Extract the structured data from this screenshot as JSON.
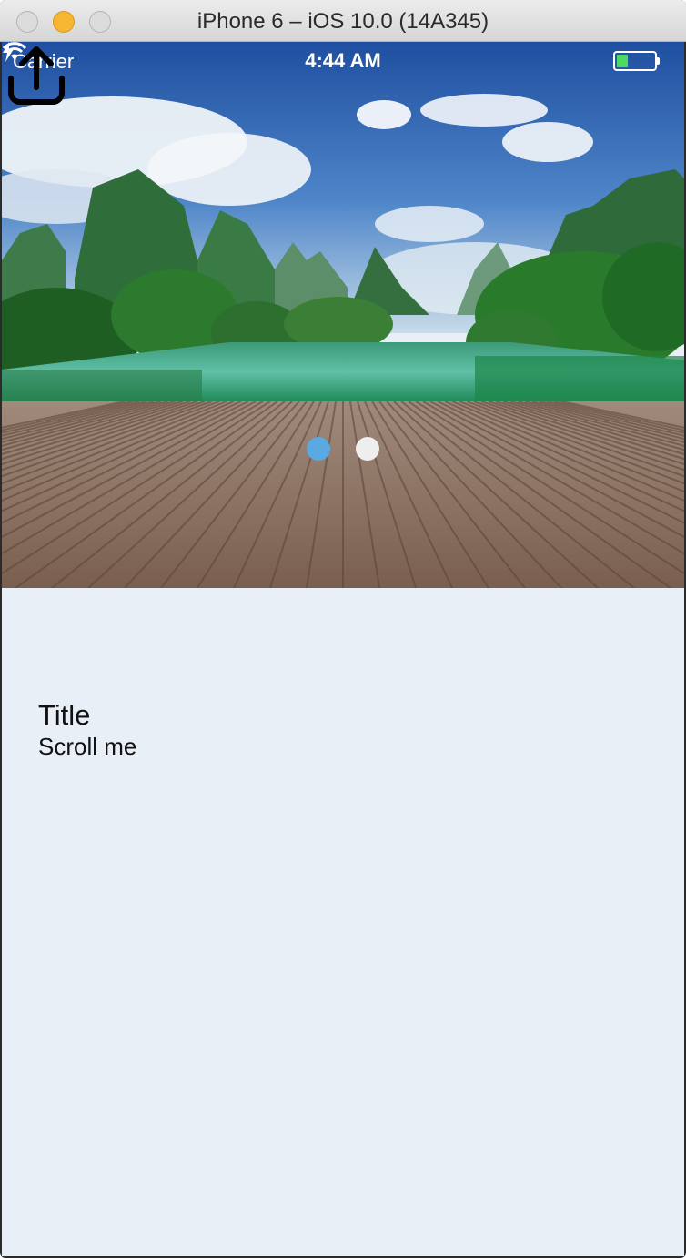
{
  "window": {
    "title": "iPhone 6 – iOS 10.0 (14A345)"
  },
  "status_bar": {
    "carrier": "Carrier",
    "time": "4:44 AM",
    "battery_level": 0.3,
    "charging": true
  },
  "toolbar": {
    "share_icon": "share-icon"
  },
  "carousel": {
    "pages": 2,
    "current_page": 1,
    "active_color": "#5aa9e0",
    "inactive_color": "#eeeeee"
  },
  "content": {
    "title": "Title",
    "subtitle": "Scroll me"
  },
  "colors": {
    "background": "#e9eff6",
    "battery_fill": "#4cd964"
  }
}
